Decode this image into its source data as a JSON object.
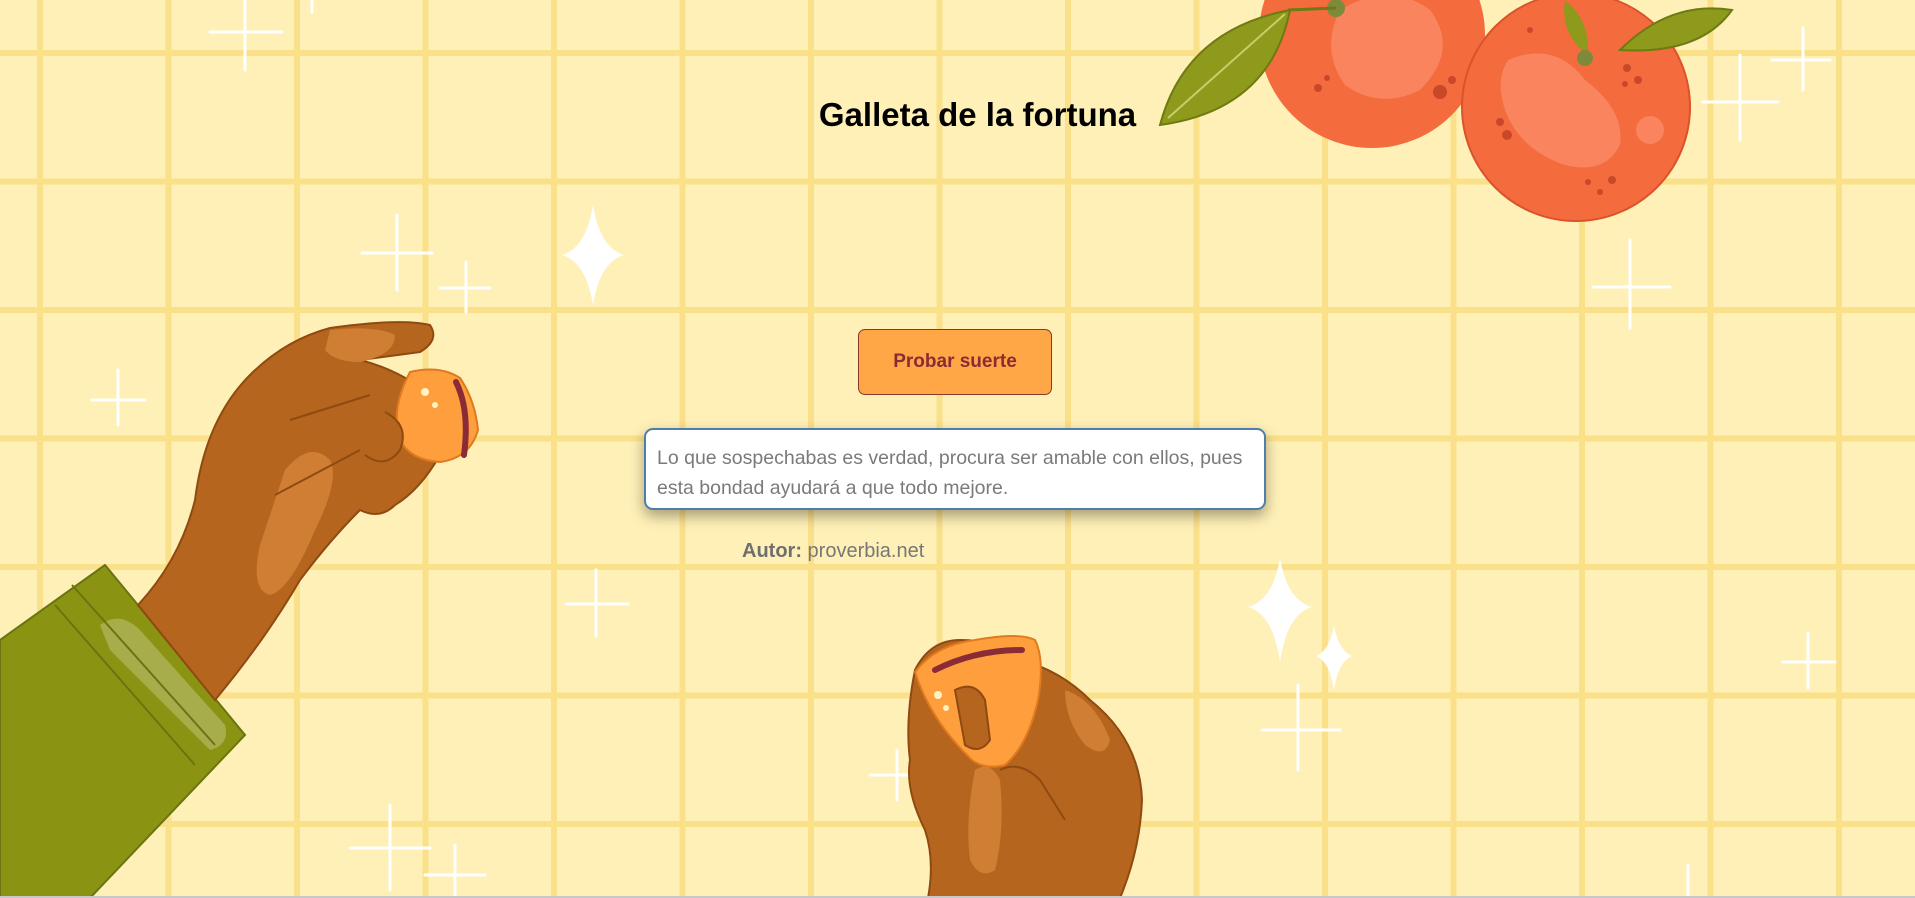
{
  "page": {
    "title": "Galleta de la fortuna"
  },
  "actions": {
    "luck_button_label": "Probar suerte"
  },
  "fortune": {
    "message": "Lo que sospechabas es verdad, procura ser amable con ellos, pues esta bondad ayudará a que todo mejore.",
    "author_label": "Autor:",
    "author_value": "proverbia.net"
  },
  "theme": {
    "background": "#fef0b6",
    "grid_line": "#fbe08a",
    "button_fill": "#ffa646",
    "button_text": "#8a2c36",
    "skin": "#b5651d",
    "sleeve": "#8a9412",
    "cookie": "#ff9e3d",
    "orange": "#f46b3e",
    "leaf": "#8d9a1c"
  },
  "decorations": {
    "icons": [
      "sparkle-icon",
      "hand-with-cookie-illustration",
      "orange-fruit-illustration",
      "fortune-cookie-icon"
    ]
  }
}
